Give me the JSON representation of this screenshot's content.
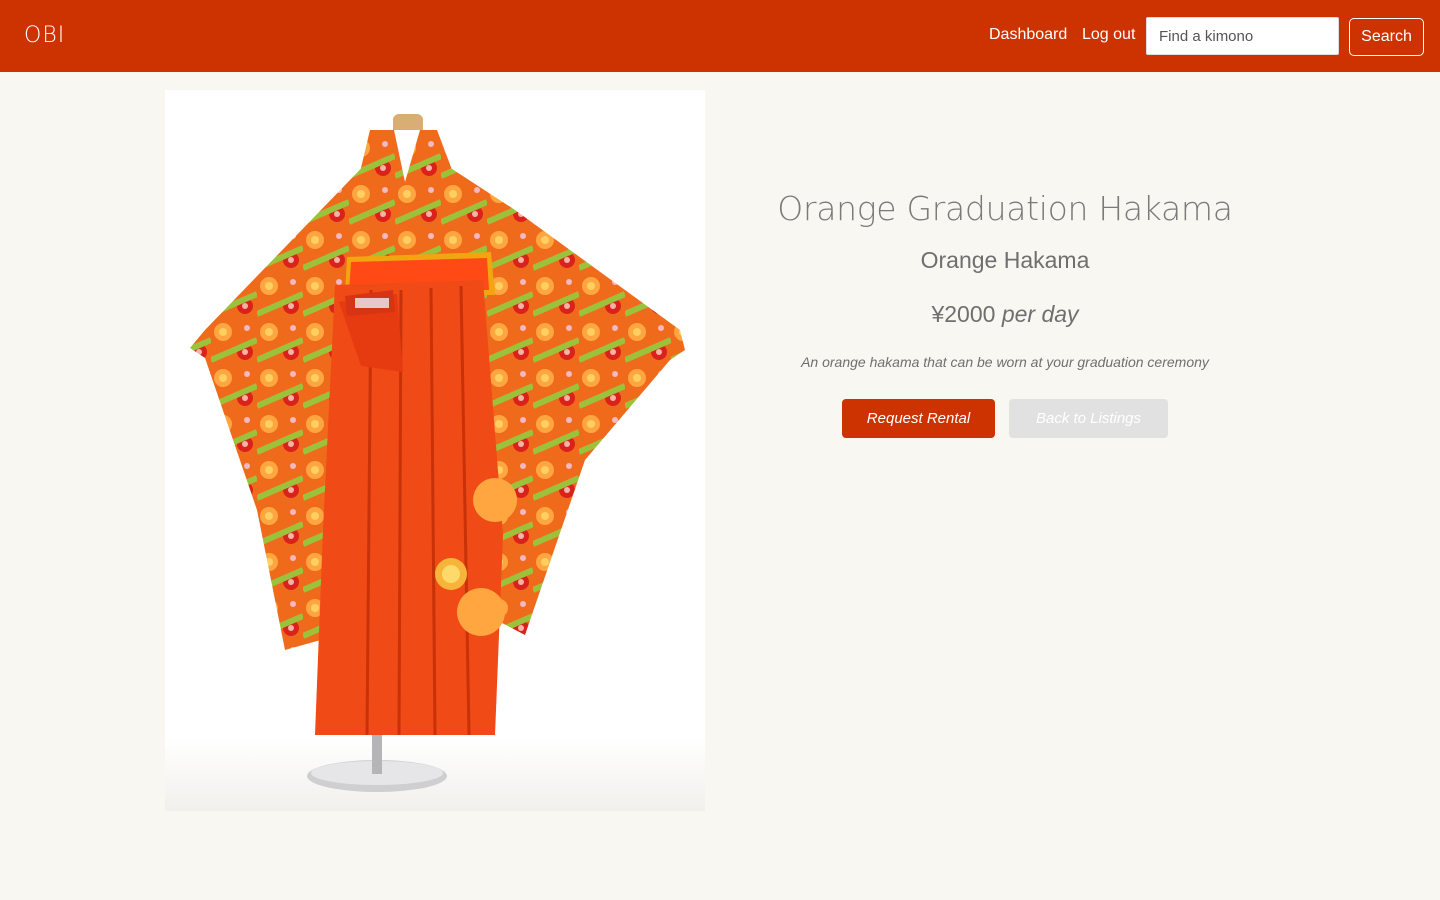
{
  "navbar": {
    "brand": "OBI",
    "brand_color": "#cc3300",
    "links": {
      "dashboard": "Dashboard",
      "logout": "Log out"
    },
    "search": {
      "placeholder": "Find a kimono",
      "value": "",
      "button_label": "Search"
    }
  },
  "listing": {
    "title": "Orange Graduation Hakama",
    "subtitle": "Orange Hakama",
    "price": "¥2000",
    "price_unit": "per day",
    "description": "An orange hakama that can be worn at your graduation ceremony",
    "image": "orange hakama kimono on mannequin stand",
    "actions": {
      "request": "Request Rental",
      "back": "Back to Listings"
    }
  }
}
